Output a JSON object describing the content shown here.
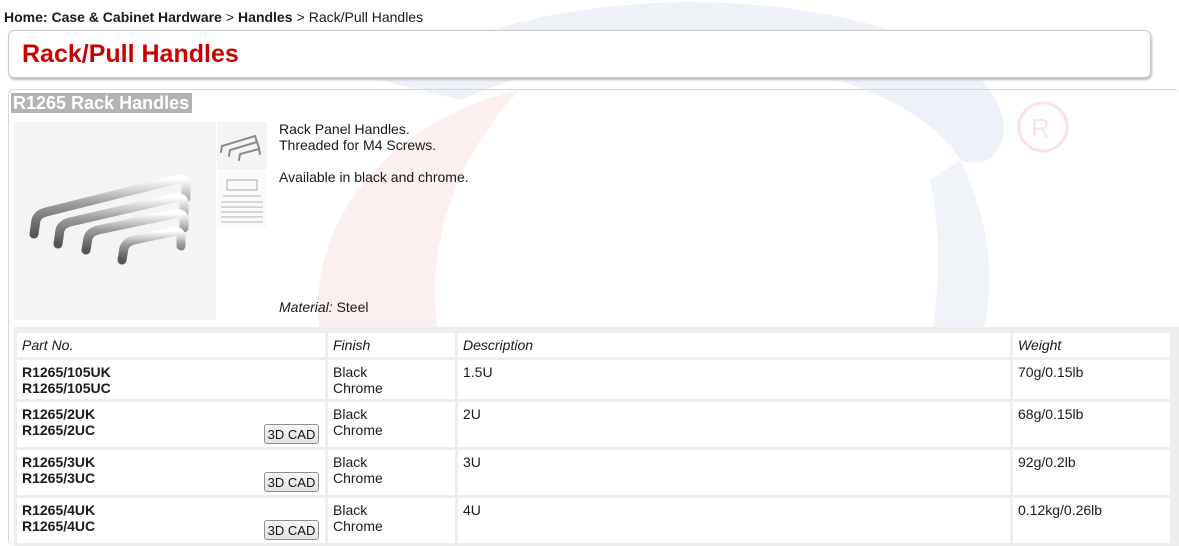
{
  "breadcrumb": {
    "home_label": "Home:",
    "items": [
      "Case & Cabinet Hardware",
      "Handles",
      "Rack/Pull Handles"
    ],
    "separator": ">"
  },
  "page_title": "Rack/Pull Handles",
  "product": {
    "title": "R1265 Rack Handles",
    "description": [
      "Rack Panel Handles.",
      "Threaded for M4 Screws.",
      "Available in black and chrome."
    ],
    "material_label": "Material:",
    "material_value": "Steel"
  },
  "table": {
    "headers": [
      "Part No.",
      "Finish",
      "Description",
      "Weight"
    ],
    "cad_label": "3D CAD",
    "rows": [
      {
        "parts": [
          "R1265/105UK",
          "R1265/105UC"
        ],
        "finish": [
          "Black",
          "Chrome"
        ],
        "description": "1.5U",
        "weight": "70g/0.15lb",
        "cad": false
      },
      {
        "parts": [
          "R1265/2UK",
          "R1265/2UC"
        ],
        "finish": [
          "Black",
          "Chrome"
        ],
        "description": "2U",
        "weight": "68g/0.15lb",
        "cad": true
      },
      {
        "parts": [
          "R1265/3UK",
          "R1265/3UC"
        ],
        "finish": [
          "Black",
          "Chrome"
        ],
        "description": "3U",
        "weight": "92g/0.2lb",
        "cad": true
      },
      {
        "parts": [
          "R1265/4UK",
          "R1265/4UC"
        ],
        "finish": [
          "Black",
          "Chrome"
        ],
        "description": "4U",
        "weight": "0.12kg/0.26lb",
        "cad": true
      }
    ]
  },
  "colors": {
    "title_red": "#cc0000",
    "product_title_bg": "#b3b3b3",
    "table_bg": "#eeeeee"
  }
}
